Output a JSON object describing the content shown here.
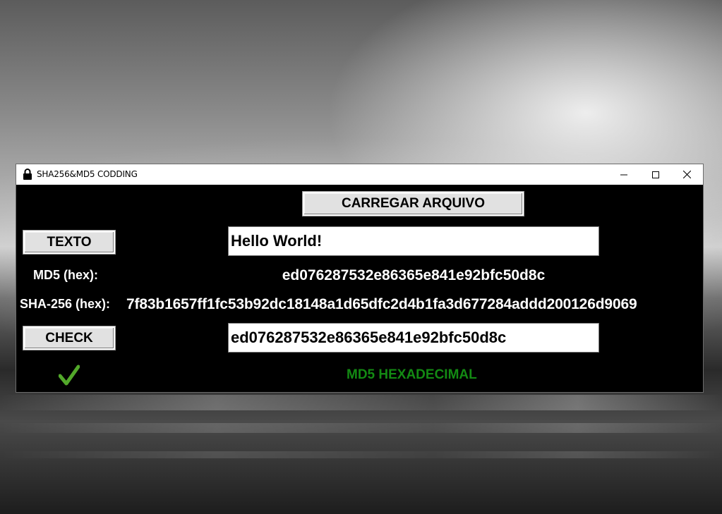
{
  "window": {
    "title": "SHA256&MD5 CODDING"
  },
  "toolbar": {
    "load_file_label": "CARREGAR ARQUIVO"
  },
  "text_row": {
    "button_label": "TEXTO",
    "input_value": "Hello World!"
  },
  "md5": {
    "label": "MD5 (hex):",
    "value": "ed076287532e86365e841e92bfc50d8c"
  },
  "sha256": {
    "label": "SHA-256 (hex):",
    "value": "7f83b1657ff1fc53b92dc18148a1d65dfc2d4b1fa3d677284addd200126d9069"
  },
  "check_row": {
    "button_label": "CHECK",
    "input_value": "ed076287532e86365e841e92bfc50d8c"
  },
  "result": {
    "status_text": "MD5 HEXADECIMAL",
    "status_color": "#138a13",
    "check_icon_color": "#52a82a"
  }
}
